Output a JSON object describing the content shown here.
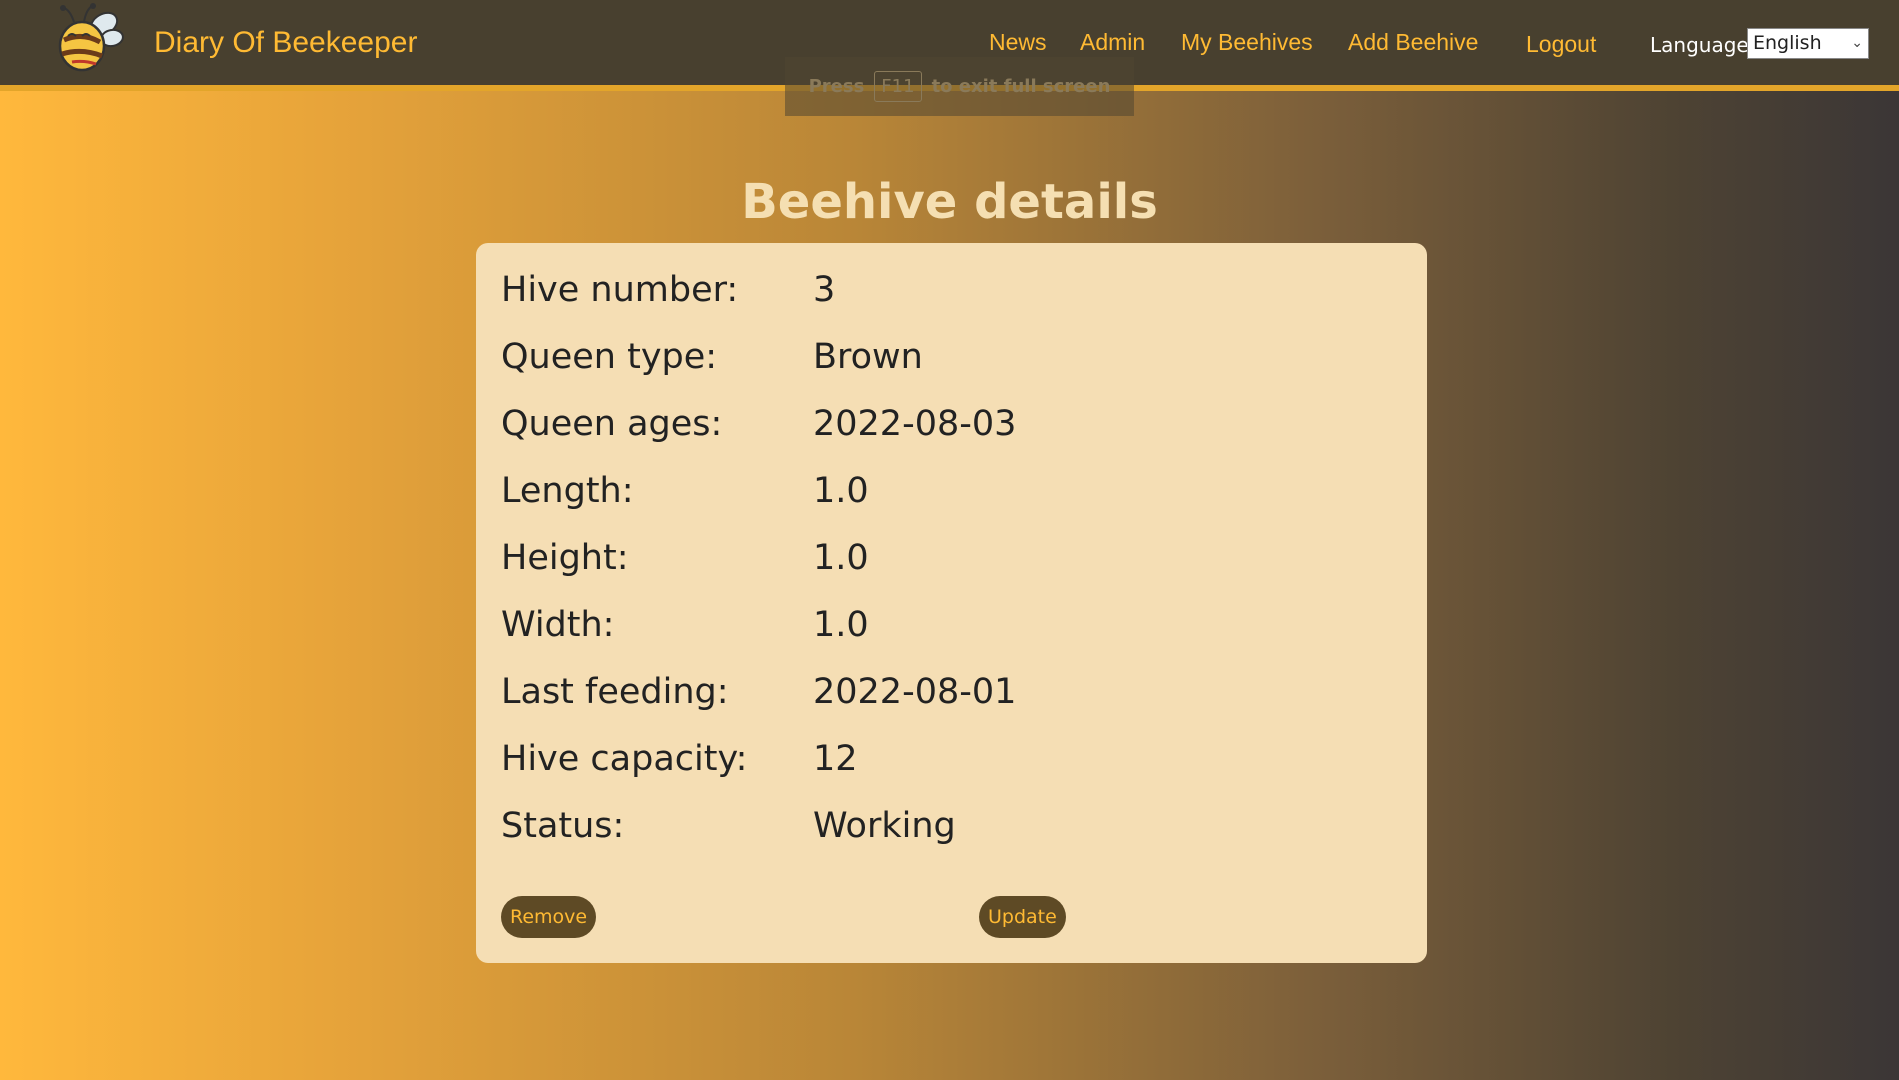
{
  "header": {
    "brand": "Diary Of Beekeeper",
    "logo_icon": "bee-icon",
    "nav": [
      {
        "label": "News"
      },
      {
        "label": "Admin"
      },
      {
        "label": "My Beehives"
      },
      {
        "label": "Add Beehive"
      },
      {
        "label": "Logout"
      }
    ],
    "language_label": "Language",
    "language_selected": "English"
  },
  "fullscreen_hint": {
    "prefix": "Press",
    "key": "F11",
    "suffix": "to exit full screen"
  },
  "main": {
    "title": "Beehive details",
    "details": [
      {
        "label": "Hive number:",
        "value": "3"
      },
      {
        "label": "Queen type:",
        "value": "Brown"
      },
      {
        "label": "Queen ages:",
        "value": "2022-08-03"
      },
      {
        "label": "Length:",
        "value": "1.0"
      },
      {
        "label": "Height:",
        "value": "1.0"
      },
      {
        "label": "Width:",
        "value": "1.0"
      },
      {
        "label": "Last feeding:",
        "value": "2022-08-01"
      },
      {
        "label": "Hive capacity:",
        "value": "12"
      },
      {
        "label": "Status:",
        "value": "Working"
      }
    ],
    "remove_label": "Remove",
    "update_label": "Update"
  },
  "colors": {
    "accent": "#ffba33",
    "navbar": "#48402f",
    "card": "#f5deb4",
    "button": "#5e4a25"
  }
}
